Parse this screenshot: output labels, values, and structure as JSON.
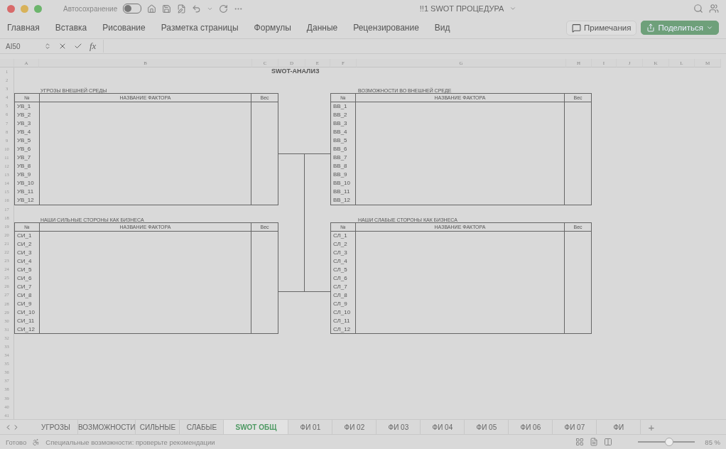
{
  "title_bar": {
    "autosave_label": "Автосохранение",
    "autosave_on": false,
    "document_title": "!!1 SWOT ПРОЦЕДУРА"
  },
  "ribbon_tabs": [
    "Главная",
    "Вставка",
    "Рисование",
    "Разметка страницы",
    "Формулы",
    "Данные",
    "Рецензирование",
    "Вид"
  ],
  "comments_button": "Примечания",
  "share_button": "Поделиться",
  "formula_bar": {
    "cell_ref": "AI50",
    "fx": "fx"
  },
  "columns": [
    "A",
    "B",
    "C",
    "D",
    "E",
    "F",
    "G",
    "H",
    "I",
    "J",
    "K",
    "L",
    "M"
  ],
  "rows": [
    "1",
    "2",
    "3",
    "4",
    "5",
    "6",
    "7",
    "8",
    "9",
    "10",
    "11",
    "12",
    "13",
    "14",
    "15",
    "16",
    "17",
    "18",
    "19",
    "20",
    "21",
    "22",
    "23",
    "24",
    "25",
    "26",
    "27",
    "28",
    "29",
    "30",
    "31",
    "32",
    "33",
    "34",
    "35",
    "36",
    "37",
    "38",
    "39",
    "40",
    "41"
  ],
  "sheet_title": "SWOT-АНАЛИЗ",
  "tables": [
    {
      "title": "УГРОЗЫ ВНЕШНЕЙ СРЕДЫ",
      "header_no": "№",
      "header_name": "НАЗВАНИЕ ФАКТОРА",
      "header_weight": "Вес",
      "codes": [
        "УВ_1",
        "УВ_2",
        "УВ_3",
        "УВ_4",
        "УВ_5",
        "УВ_6",
        "УВ_7",
        "УВ_8",
        "УВ_9",
        "УВ_10",
        "УВ_11",
        "УВ_12"
      ]
    },
    {
      "title": "ВОЗМОЖНОСТИ ВО ВНЕШНЕЙ СРЕДЕ",
      "header_no": "№",
      "header_name": "НАЗВАНИЕ ФАКТОРА",
      "header_weight": "Вес",
      "codes": [
        "ВВ_1",
        "ВВ_2",
        "ВВ_3",
        "ВВ_4",
        "ВВ_5",
        "ВВ_6",
        "ВВ_7",
        "ВВ_8",
        "ВВ_9",
        "ВВ_10",
        "ВВ_11",
        "ВВ_12"
      ]
    },
    {
      "title": "НАШИ СИЛЬНЫЕ СТОРОНЫ КАК БИЗНЕСА",
      "header_no": "№",
      "header_name": "НАЗВАНИЕ ФАКТОРА",
      "header_weight": "Вес",
      "codes": [
        "СИ_1",
        "СИ_2",
        "СИ_3",
        "СИ_4",
        "СИ_5",
        "СИ_6",
        "СИ_7",
        "СИ_8",
        "СИ_9",
        "СИ_10",
        "СИ_11",
        "СИ_12"
      ]
    },
    {
      "title": "НАШИ СЛАБЫЕ СТОРОНЫ КАК БИЗНЕСА",
      "header_no": "№",
      "header_name": "НАЗВАНИЕ ФАКТОРА",
      "header_weight": "Вес",
      "codes": [
        "СЛ_1",
        "СЛ_2",
        "СЛ_3",
        "СЛ_4",
        "СЛ_5",
        "СЛ_6",
        "СЛ_7",
        "СЛ_8",
        "СЛ_9",
        "СЛ_10",
        "СЛ_11",
        "СЛ_12"
      ]
    }
  ],
  "sheet_tabs": [
    {
      "label": "УГРОЗЫ",
      "selected": false
    },
    {
      "label": "ВОЗМОЖНОСТИ",
      "selected": false
    },
    {
      "label": "СИЛЬНЫЕ",
      "selected": false
    },
    {
      "label": "СЛАБЫЕ",
      "selected": false
    },
    {
      "label": "SWOT ОБЩ",
      "selected": true
    },
    {
      "label": "ФИ 01",
      "selected": false
    },
    {
      "label": "ФИ 02",
      "selected": false
    },
    {
      "label": "ФИ 03",
      "selected": false
    },
    {
      "label": "ФИ 04",
      "selected": false
    },
    {
      "label": "ФИ 05",
      "selected": false
    },
    {
      "label": "ФИ 06",
      "selected": false
    },
    {
      "label": "ФИ 07",
      "selected": false
    },
    {
      "label": "ФИ",
      "selected": false
    }
  ],
  "add_sheet": "+",
  "status_bar": {
    "status": "Готово",
    "accessibility": "Специальные возможности: проверьте рекомендации",
    "zoom": "85 %",
    "zoom_level": {
      "level": 0.55
    }
  }
}
